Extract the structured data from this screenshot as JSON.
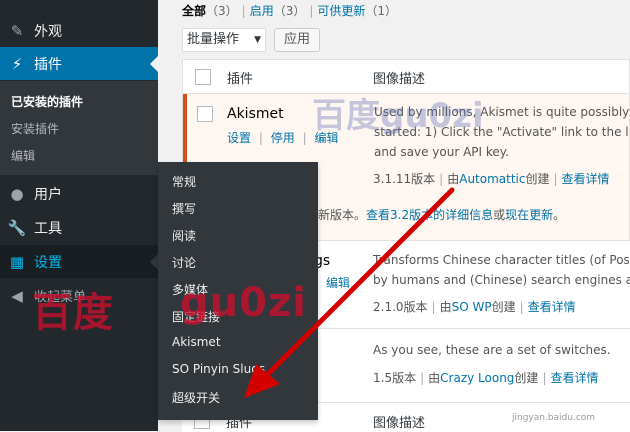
{
  "sidebar": {
    "appearance": "外观",
    "plugins": "插件",
    "installed_plugins": "已安装的插件",
    "add_plugin": "安装插件",
    "editor": "编辑",
    "users": "用户",
    "tools": "工具",
    "settings": "设置",
    "collapse": "收起菜单",
    "active_color": "#0073aa"
  },
  "settings_flyout": [
    "常规",
    "撰写",
    "阅读",
    "讨论",
    "多媒体",
    "固定链接",
    "Akismet",
    "SO Pinyin Slugs",
    "超级开关"
  ],
  "filters": {
    "all": "全部",
    "all_count": "（3）",
    "enabled": "启用",
    "enabled_count": "（3）",
    "updates": "可供更新",
    "updates_count": "（1）",
    "divider": "|"
  },
  "bulk_actions": {
    "selected": "批量操作",
    "apply": "应用"
  },
  "table": {
    "col_plugin": "插件",
    "col_description": "图像描述",
    "rows": [
      {
        "name": "Akismet",
        "actions": [
          "设置",
          "停用",
          "编辑"
        ],
        "desc_lines": [
          "Used by millions, Akismet is quite possibly t",
          "started: 1) Click the \"Activate\" link to the left",
          "and save your API key."
        ],
        "version": "3.1.11版本",
        "by": "由",
        "author": "Automattic",
        "created": "创建",
        "details": "查看详情",
        "update_prefix": "新版本。",
        "update_link": "查看3.2版本的详细信息",
        "update_or": "或",
        "update_now": "现在更新",
        "update_end": "。"
      },
      {
        "name_fragment": "gs",
        "action_fragment": "编辑",
        "desc_lines": [
          "Transforms Chinese character titles (of Post",
          "by humans and (Chinese) search engines ali"
        ],
        "version": "2.1.0版本",
        "by": "由",
        "author": "SO WP",
        "created": "创建",
        "details": "查看详情"
      },
      {
        "desc_lines": [
          "As you see, these are a set of switches."
        ],
        "version": "1.5版本",
        "by": "由",
        "author": "Crazy Loong",
        "created": "创建",
        "details": "查看详情"
      }
    ]
  },
  "watermarks": {
    "baidu": "百度",
    "gu0zi": "gu0zi",
    "brand": "百度gu0zi",
    "site": "jingyan.baidu.com"
  }
}
